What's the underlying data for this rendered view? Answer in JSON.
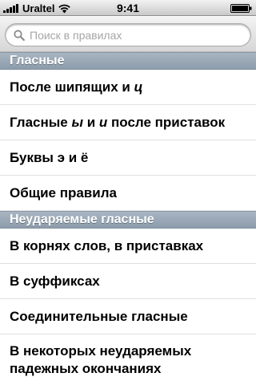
{
  "status_bar": {
    "carrier": "Uraltel",
    "time": "9:41",
    "icons": [
      "signal-bars-icon",
      "wifi-icon",
      "battery-icon"
    ]
  },
  "search": {
    "placeholder": "Поиск в правилах",
    "value": ""
  },
  "sections": [
    {
      "title": "Гласные",
      "rows": [
        {
          "parts": [
            {
              "text": "После шипящих и ",
              "italic": false
            },
            {
              "text": "ц",
              "italic": true
            }
          ]
        },
        {
          "parts": [
            {
              "text": "Гласные ",
              "italic": false
            },
            {
              "text": "ы",
              "italic": true
            },
            {
              "text": " и ",
              "italic": false
            },
            {
              "text": "и",
              "italic": true
            },
            {
              "text": " после приставок",
              "italic": false
            }
          ]
        },
        {
          "parts": [
            {
              "text": "Буквы э и ё",
              "italic": false
            }
          ]
        },
        {
          "parts": [
            {
              "text": "Общие правила",
              "italic": false
            }
          ]
        }
      ]
    },
    {
      "title": "Неударяемые гласные",
      "rows": [
        {
          "parts": [
            {
              "text": "В корнях слов, в приставках",
              "italic": false
            }
          ]
        },
        {
          "parts": [
            {
              "text": "В суффиксах",
              "italic": false
            }
          ]
        },
        {
          "parts": [
            {
              "text": "Соединительные гласные",
              "italic": false
            }
          ]
        },
        {
          "parts": [
            {
              "text": "В некоторых неударяемых падежных окончаниях",
              "italic": false
            }
          ]
        }
      ]
    }
  ],
  "colors": {
    "section_header": "#97a5b3",
    "row_text": "#000000",
    "placeholder": "#a6a6a6"
  }
}
